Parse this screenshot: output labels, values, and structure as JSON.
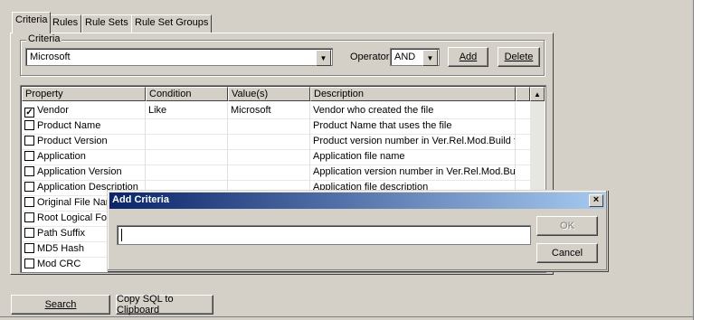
{
  "tabs": [
    "Criteria",
    "Rules",
    "Rule Sets",
    "Rule Set Groups"
  ],
  "criteria_group_label": "Criteria",
  "criteria_combo_value": "Microsoft",
  "operator_label": "Operator:",
  "operator_value": "AND",
  "add_label": "Add",
  "delete_label": "Delete",
  "grid": {
    "headers": [
      "Property",
      "Condition",
      "Value(s)",
      "Description"
    ],
    "rows": [
      {
        "property": "Vendor",
        "condition": "Like",
        "value": "Microsoft",
        "description": "Vendor who created the file",
        "checked": true
      },
      {
        "property": "Product Name",
        "condition": "",
        "value": "",
        "description": "Product Name that uses the file",
        "checked": false
      },
      {
        "property": "Product Version",
        "condition": "",
        "value": "",
        "description": "Product version number in Ver.Rel.Mod.Build for...",
        "checked": false
      },
      {
        "property": "Application",
        "condition": "",
        "value": "",
        "description": "Application file name",
        "checked": false
      },
      {
        "property": "Application Version",
        "condition": "",
        "value": "",
        "description": "Application version number in Ver.Rel.Mod.Build ...",
        "checked": false
      },
      {
        "property": "Application Description",
        "condition": "",
        "value": "",
        "description": "Application file description",
        "checked": false
      },
      {
        "property": "Original File Name",
        "condition": "",
        "value": "",
        "description": "",
        "checked": false
      },
      {
        "property": "Root Logical Folder",
        "condition": "",
        "value": "",
        "description": "",
        "checked": false
      },
      {
        "property": "Path Suffix",
        "condition": "",
        "value": "",
        "description": "",
        "checked": false
      },
      {
        "property": "MD5 Hash",
        "condition": "",
        "value": "",
        "description": "",
        "checked": false
      },
      {
        "property": "Mod CRC",
        "condition": "",
        "value": "",
        "description": "",
        "checked": false
      }
    ]
  },
  "search_label": "Search",
  "copy_sql_label": "Copy SQL to Clipboard",
  "dialog": {
    "title": "Add Criteria",
    "close_glyph": "×",
    "input_value": "",
    "ok_label": "OK",
    "cancel_label": "Cancel"
  }
}
